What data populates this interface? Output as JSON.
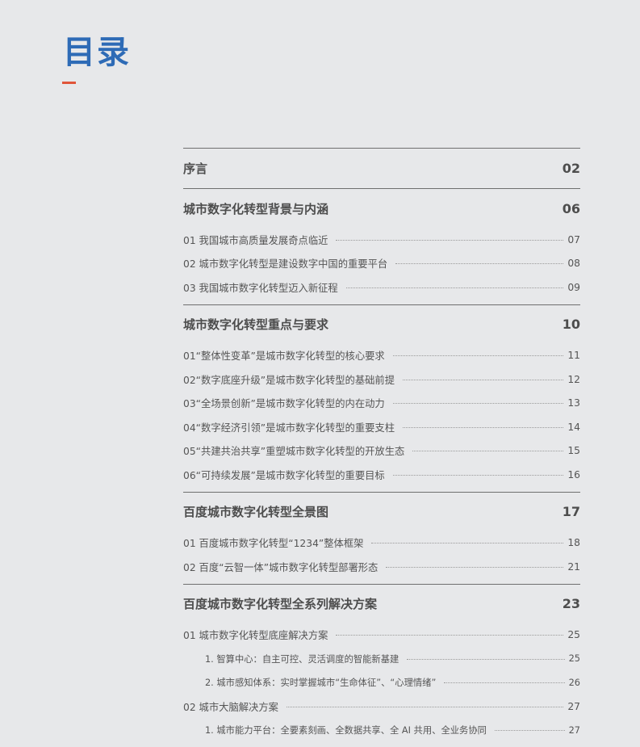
{
  "page": {
    "title": "目录",
    "colors": {
      "title": "#2e6bb6",
      "accent": "#e0553a",
      "background": "#e7e8ea"
    }
  },
  "toc": [
    {
      "title": "序言",
      "page": "02",
      "items": []
    },
    {
      "title": "城市数字化转型背景与内涵",
      "page": "06",
      "items": [
        {
          "level": 1,
          "title": "01 我国城市高质量发展奇点临近",
          "page": "07"
        },
        {
          "level": 1,
          "title": "02 城市数字化转型是建设数字中国的重要平台",
          "page": "08"
        },
        {
          "level": 1,
          "title": "03 我国城市数字化转型迈入新征程",
          "page": "09"
        }
      ]
    },
    {
      "title": "城市数字化转型重点与要求",
      "page": "10",
      "items": [
        {
          "level": 1,
          "title": "01“整体性变革”是城市数字化转型的核心要求",
          "page": "11"
        },
        {
          "level": 1,
          "title": "02“数字底座升级”是城市数字化转型的基础前提",
          "page": "12"
        },
        {
          "level": 1,
          "title": "03“全场景创新”是城市数字化转型的内在动力",
          "page": "13"
        },
        {
          "level": 1,
          "title": "04“数字经济引领”是城市数字化转型的重要支柱",
          "page": "14"
        },
        {
          "level": 1,
          "title": "05“共建共治共享”重塑城市数字化转型的开放生态",
          "page": "15"
        },
        {
          "level": 1,
          "title": "06“可持续发展”是城市数字化转型的重要目标",
          "page": "16"
        }
      ]
    },
    {
      "title": "百度城市数字化转型全景图",
      "page": "17",
      "items": [
        {
          "level": 1,
          "title": "01 百度城市数字化转型“1234”整体框架",
          "page": "18"
        },
        {
          "level": 1,
          "title": "02 百度“云智一体”城市数字化转型部署形态",
          "page": "21"
        }
      ]
    },
    {
      "title": "百度城市数字化转型全系列解决方案",
      "page": "23",
      "items": [
        {
          "level": 1,
          "title": "01 城市数字化转型底座解决方案",
          "page": "25"
        },
        {
          "level": 2,
          "title": "1. 智算中心：自主可控、灵活调度的智能新基建",
          "page": "25"
        },
        {
          "level": 2,
          "title": "2. 城市感知体系：实时掌握城市“生命体征”、“心理情绪”",
          "page": "26"
        },
        {
          "level": 1,
          "title": "02 城市大脑解决方案",
          "page": "27"
        },
        {
          "level": 2,
          "title": "1. 城市能力平台：全要素刻画、全数据共享、全 AI 共用、全业务协同",
          "page": "27"
        }
      ]
    }
  ]
}
